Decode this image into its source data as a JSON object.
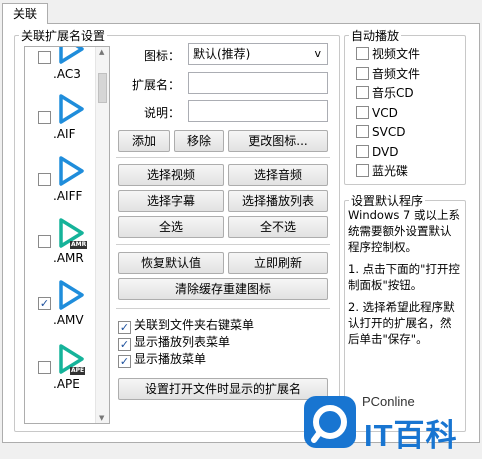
{
  "tab": {
    "label": "关联"
  },
  "left_group": {
    "legend": "关联扩展名设置"
  },
  "files": [
    {
      "ext": ".AC3",
      "checked": false,
      "badge": ""
    },
    {
      "ext": ".AIF",
      "checked": false,
      "badge": ""
    },
    {
      "ext": ".AIFF",
      "checked": false,
      "badge": ""
    },
    {
      "ext": ".AMR",
      "checked": false,
      "badge": "AMR"
    },
    {
      "ext": ".AMV",
      "checked": true,
      "badge": ""
    },
    {
      "ext": ".APE",
      "checked": false,
      "badge": "APE"
    }
  ],
  "form": {
    "icon_label": "图标：",
    "icon_value": "默认(推荐)",
    "icon_chevron": "v",
    "ext_label": "扩展名：",
    "ext_value": "",
    "desc_label": "说明：",
    "desc_value": ""
  },
  "buttons": {
    "add": "添加",
    "remove": "移除",
    "change_icon": "更改图标...",
    "select_video": "选择视频",
    "select_audio": "选择音频",
    "select_subtitle": "选择字幕",
    "select_playlist": "选择播放列表",
    "select_all": "全选",
    "select_none": "全不选",
    "restore_default": "恢复默认值",
    "refresh_now": "立即刷新",
    "clear_cache": "清除缓存重建图标",
    "set_open_ext": "设置打开文件时显示的扩展名"
  },
  "options": [
    {
      "label": "关联到文件夹右键菜单",
      "checked": true
    },
    {
      "label": "显示播放列表菜单",
      "checked": true
    },
    {
      "label": "显示播放菜单",
      "checked": true
    }
  ],
  "autoplay": {
    "legend": "自动播放",
    "items": [
      {
        "label": "视频文件",
        "checked": false
      },
      {
        "label": "音频文件",
        "checked": false
      },
      {
        "label": "音乐CD",
        "checked": false
      },
      {
        "label": "VCD",
        "checked": false
      },
      {
        "label": "SVCD",
        "checked": false
      },
      {
        "label": "DVD",
        "checked": false
      },
      {
        "label": "蓝光碟",
        "checked": false
      }
    ]
  },
  "default_program": {
    "legend": "设置默认程序",
    "text1": "Windows 7 或以上系统需要额外设置默认程序控制权。",
    "text2": "1. 点击下面的\"打开控制面板\"按钮。",
    "text3": "2. 选择希望此程序默认打开的扩展名，然后单击\"保存\"。"
  },
  "watermark": {
    "brand": "PConline",
    "name": "IT百科"
  },
  "icons": {
    "play": "play-triangle-icon",
    "colors": {
      "blue": "#1f8ddb",
      "teal": "#15b39a",
      "brand": "#1875d1"
    }
  }
}
